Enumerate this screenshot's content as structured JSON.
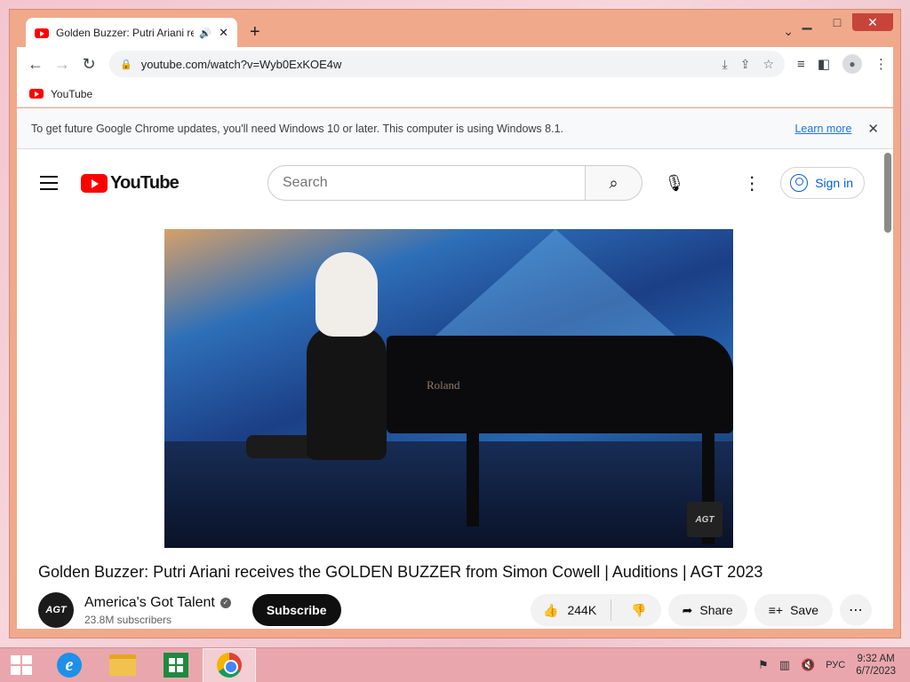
{
  "browser": {
    "tab_title": "Golden Buzzer: Putri Ariani re",
    "url": "youtube.com/watch?v=Wyb0ExKOE4w",
    "bookmark_label": "YouTube",
    "infobar_message": "To get future Google Chrome updates, you'll need Windows 10 or later. This computer is using Windows 8.1.",
    "infobar_link": "Learn more"
  },
  "youtube": {
    "logo_text": "YouTube",
    "search_placeholder": "Search",
    "sign_in": "Sign in",
    "video_title": "Golden Buzzer: Putri Ariani receives the GOLDEN BUZZER from Simon Cowell | Auditions | AGT 2023",
    "video_overlay_text": "Roland",
    "video_logo": "AGT",
    "channel_name": "America's Got Talent",
    "channel_avatar": "AGT",
    "subscribers": "23.8M subscribers",
    "subscribe_label": "Subscribe",
    "likes": "244K",
    "share_label": "Share",
    "save_label": "Save"
  },
  "taskbar": {
    "language": "РУС",
    "time": "9:32 AM",
    "date": "6/7/2023"
  },
  "colors": {
    "window_frame": "#f1a98c",
    "youtube_red": "#ff0000",
    "link_blue": "#065fd4",
    "taskbar": "#e9a7ad"
  }
}
